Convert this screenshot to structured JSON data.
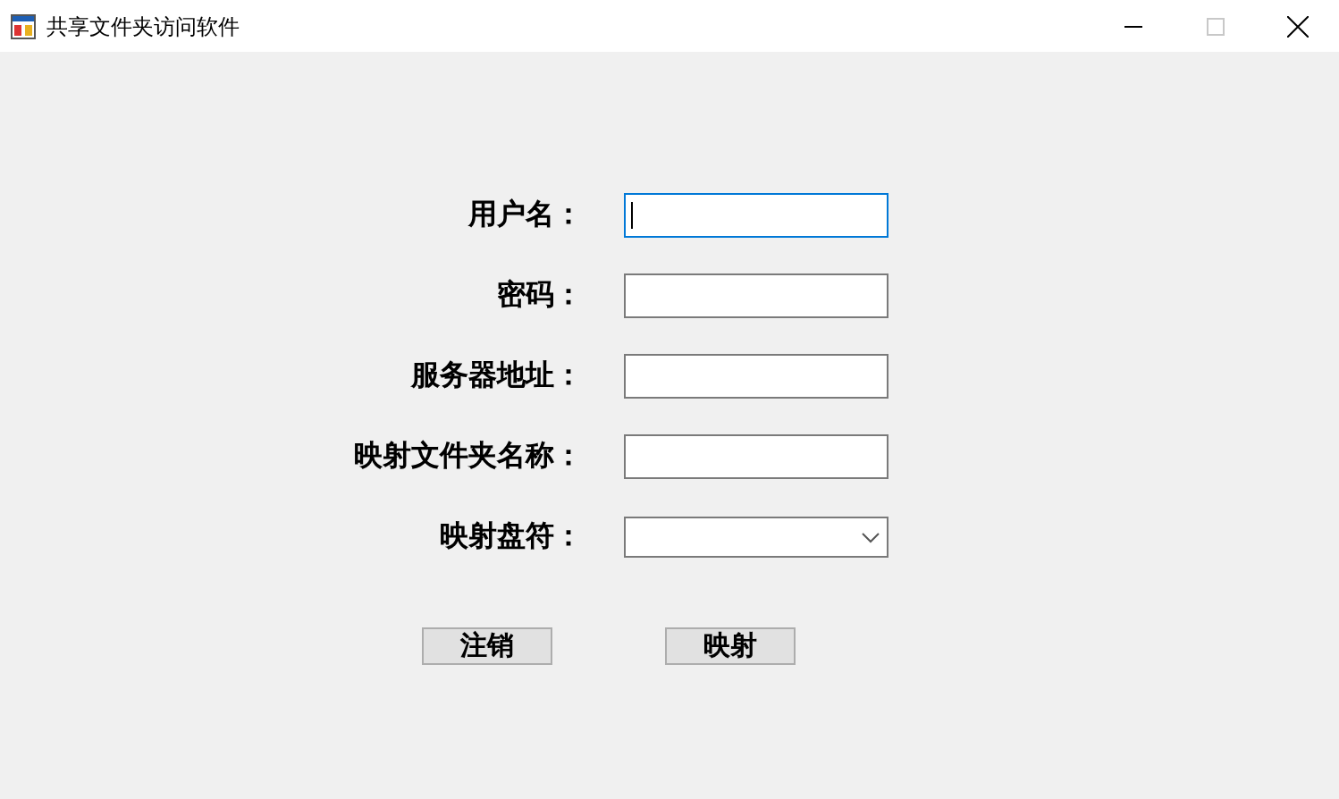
{
  "window": {
    "title": "共享文件夹访问软件",
    "maximize_disabled": true
  },
  "fields": [
    {
      "label": "用户名：",
      "kind": "text",
      "focused": true
    },
    {
      "label": "密码：",
      "kind": "text",
      "focused": false
    },
    {
      "label": "服务器地址：",
      "kind": "text",
      "focused": false
    },
    {
      "label": "映射文件夹名称：",
      "kind": "text",
      "focused": false
    },
    {
      "label": "映射盘符：",
      "kind": "select",
      "focused": false
    }
  ],
  "buttons": [
    "注销",
    "映射"
  ]
}
